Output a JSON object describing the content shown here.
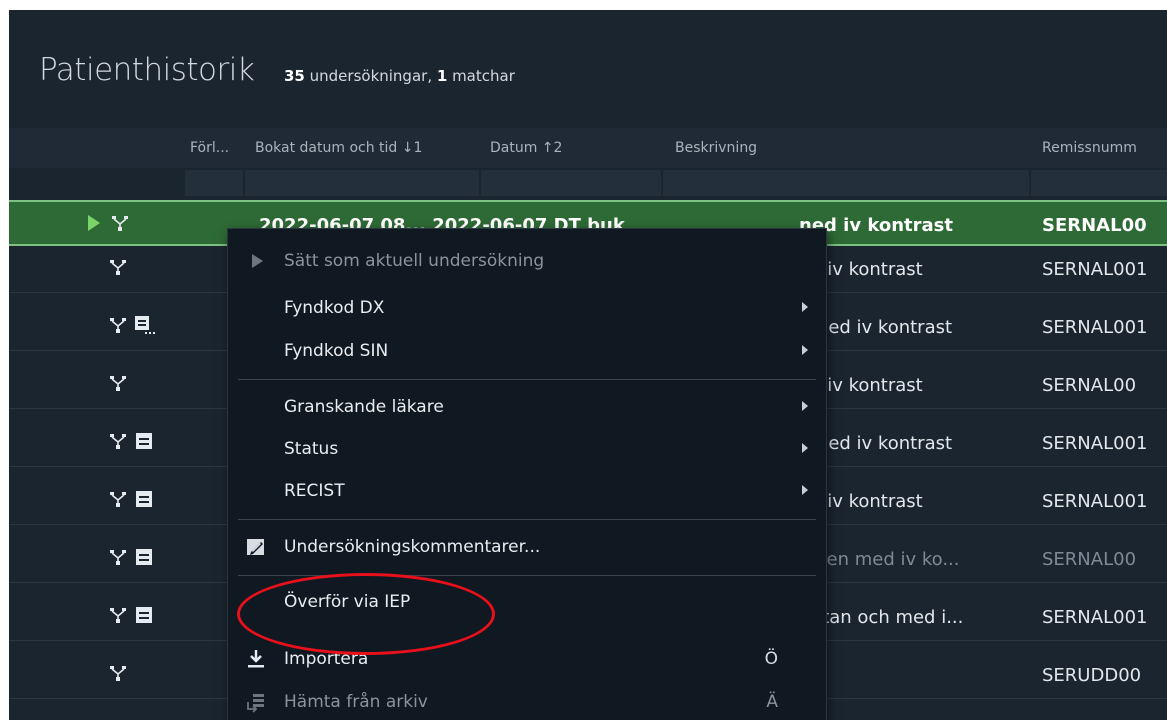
{
  "header": {
    "title": "Patienthistorik",
    "count_number": "35",
    "count_label": " undersökningar, ",
    "match_number": "1",
    "match_label": " matchar"
  },
  "columns": [
    {
      "label": "Förl..."
    },
    {
      "label": "Bokat datum och tid ↓1"
    },
    {
      "label": "Datum ↑2"
    },
    {
      "label": "Beskrivning"
    },
    {
      "label": "Remissnumm"
    }
  ],
  "rows": [
    {
      "obscured": "2022-06-07  08...   2022-06-07   DT buk",
      "description": "ned iv kontrast",
      "remiss": "SERNAL00",
      "selected": true,
      "icons": [
        "play-icon",
        "branch-icon"
      ]
    },
    {
      "description": "ed iv kontrast",
      "remiss": "SERNAL001",
      "icons": [
        "branch-icon"
      ]
    },
    {
      "description": ": med iv kontrast",
      "remiss": "SERNAL001",
      "icons": [
        "branch-icon",
        "note-comment-icon"
      ]
    },
    {
      "description": "ed iv kontrast",
      "remiss": "SERNAL00",
      "icons": [
        "branch-icon"
      ]
    },
    {
      "description": ": med iv kontrast",
      "remiss": "SERNAL001",
      "icons": [
        "branch-icon",
        "archive-icon"
      ]
    },
    {
      "description": "ed iv kontrast",
      "remiss": "SERNAL001",
      "icons": [
        "branch-icon",
        "archive-icon"
      ]
    },
    {
      "description": "delen med iv ko...",
      "remiss": "SERNAL00",
      "dim": true,
      "icons": [
        "branch-icon",
        "archive-icon"
      ]
    },
    {
      "description": ": utan och med i...",
      "remiss": "SERNAL001",
      "icons": [
        "branch-icon",
        "archive-icon"
      ]
    },
    {
      "description": "",
      "remiss": "SERUDD00",
      "icons": [
        "branch-icon"
      ]
    }
  ],
  "menu": {
    "items": [
      {
        "label": "Sätt som aktuell undersökning",
        "disabled": true,
        "icon": "play-icon"
      },
      {
        "label": "Fyndkod DX",
        "submenu": true
      },
      {
        "label": "Fyndkod SIN",
        "submenu": true
      },
      {
        "label": "Granskande läkare",
        "submenu": true
      },
      {
        "label": "Status",
        "submenu": true
      },
      {
        "label": "RECIST",
        "submenu": true
      },
      {
        "label": "Undersökningskommentarer...",
        "icon": "edit-comment-icon"
      },
      {
        "label": "Överför via IEP"
      },
      {
        "label": "Importera",
        "shortcut": "Ö",
        "icon": "download-icon"
      },
      {
        "label": "Hämta från arkiv",
        "shortcut": "Ä",
        "disabled": true,
        "icon": "archive-retrieve-icon"
      }
    ]
  },
  "colors": {
    "background": "#1b2530",
    "selected_row": "#2e6a35",
    "annotation": "#e8101a"
  }
}
